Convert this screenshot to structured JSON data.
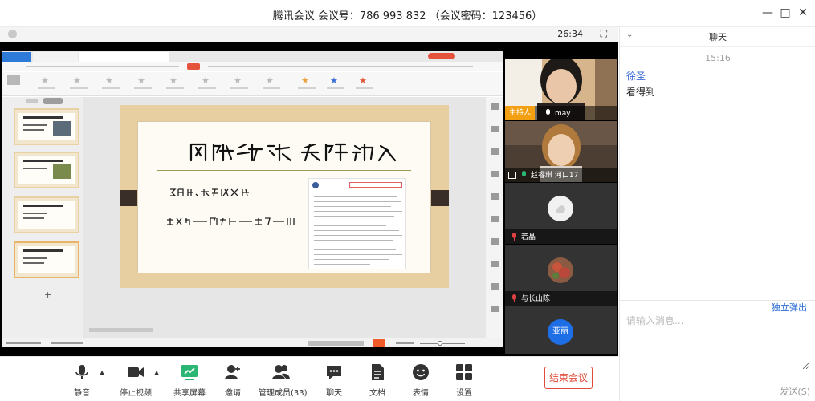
{
  "window": {
    "title": "腾讯会议 会议号：786 993 832 （会议密码：123456）"
  },
  "share_header": {
    "timer": "26:34"
  },
  "participants": [
    {
      "name": "may",
      "host_badge": "主持人",
      "mic_muted": false
    },
    {
      "name": "赵睿琪 河口17",
      "mic_muted": false
    },
    {
      "name": "若晶",
      "mic_muted": true
    },
    {
      "name": "与长山陈",
      "mic_muted": true
    },
    {
      "name": "亚丽",
      "avatar_text": "亚丽",
      "avatar_color": "#1e6fe6"
    }
  ],
  "toolbar": {
    "mute": "静音",
    "stop_video": "停止视频",
    "share_screen": "共享屏幕",
    "invite": "邀请",
    "manage_members": "管理成员(33)",
    "chat": "聊天",
    "docs": "文档",
    "reactions": "表情",
    "settings": "设置",
    "end_meeting": "结束会议"
  },
  "chat": {
    "title": "聊天",
    "time": "15:16",
    "messages": [
      {
        "sender": "徐圣",
        "text": "看得到"
      }
    ],
    "popout": "独立弹出",
    "input_placeholder": "请输入消息...",
    "send": "发送(S)"
  },
  "colors": {
    "accent_blue": "#2a6ad6",
    "end_red": "#e04a3a",
    "host_orange": "#f2a012",
    "share_green": "#2bb673"
  }
}
